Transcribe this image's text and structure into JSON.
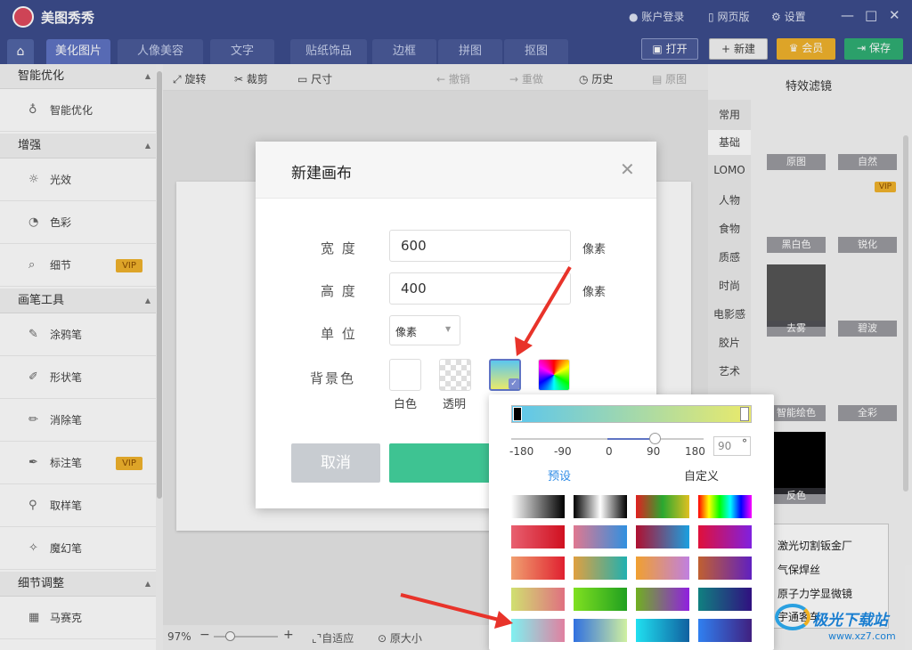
{
  "app": {
    "title": "美图秀秀",
    "account": "账户登录",
    "web": "网页版",
    "settings": "设置"
  },
  "tabs": [
    "美化图片",
    "人像美容",
    "文字",
    "贴纸饰品",
    "边框",
    "拼图",
    "抠图"
  ],
  "header_buttons": {
    "open": "打开",
    "new": "新建",
    "member": "会员",
    "save": "保存"
  },
  "left_panel": {
    "sections": [
      {
        "title": "智能优化",
        "items": [
          {
            "label": "智能优化",
            "icon": "bulb-icon"
          }
        ]
      },
      {
        "title": "增强",
        "items": [
          {
            "label": "光效",
            "icon": "sun-icon"
          },
          {
            "label": "色彩",
            "icon": "palette-icon"
          },
          {
            "label": "细节",
            "icon": "magnifier-icon",
            "badge": "VIP"
          }
        ]
      },
      {
        "title": "画笔工具",
        "items": [
          {
            "label": "涂鸦笔",
            "icon": "doodle-icon"
          },
          {
            "label": "形状笔",
            "icon": "shape-pen-icon"
          },
          {
            "label": "消除笔",
            "icon": "eraser-pen-icon"
          },
          {
            "label": "标注笔",
            "icon": "marker-pen-icon",
            "badge": "VIP"
          },
          {
            "label": "取样笔",
            "icon": "dropper-icon"
          },
          {
            "label": "魔幻笔",
            "icon": "magic-wand-icon"
          }
        ]
      },
      {
        "title": "细节调整",
        "items": [
          {
            "label": "马赛克",
            "icon": "mosaic-icon"
          }
        ]
      }
    ]
  },
  "toolbar": {
    "rotate": "旋转",
    "crop": "裁剪",
    "size": "尺寸",
    "undo": "撤销",
    "redo": "重做",
    "history": "历史",
    "original": "原图"
  },
  "status": {
    "zoom": "97%",
    "fit": "自适应",
    "actual": "原大小"
  },
  "filters": {
    "title": "特效滤镜",
    "categories": [
      "常用",
      "基础",
      "LOMO",
      "人物",
      "食物",
      "质感",
      "时尚",
      "电影感",
      "胶片",
      "艺术"
    ],
    "thumbs": [
      "原图",
      "自然",
      "黑白色",
      "锐化",
      "去雾",
      "碧波",
      "智能绘色",
      "全彩",
      "反色"
    ],
    "vip": "VIP"
  },
  "dialog": {
    "title": "新建画布",
    "width_label": "宽 度",
    "width_value": "600",
    "height_label": "高 度",
    "height_value": "400",
    "unit_label": "单 位",
    "unit_value": "像素",
    "px": "像素",
    "bg_label": "背景色",
    "bg_options": [
      "白色",
      "透明"
    ],
    "cancel": "取消"
  },
  "color_popup": {
    "ticks": [
      "-180",
      "-90",
      "0",
      "90",
      "180"
    ],
    "angle_value": "90",
    "degree": "°",
    "angle_fraction": 0.75,
    "preset": "预设",
    "custom": "自定义"
  },
  "ad_text": [
    "激光切割钣金厂",
    "气保焊丝",
    "原子力学显微镜",
    "宇通客车"
  ],
  "watermark": {
    "name": "极光下载站",
    "url": "www.xz7.com"
  }
}
